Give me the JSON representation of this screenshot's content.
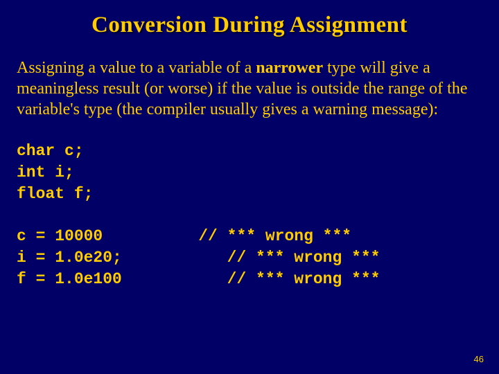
{
  "title": "Conversion During Assignment",
  "paragraph_pre": "Assigning a value to a variable of a ",
  "paragraph_bold": "narrower",
  "paragraph_post": " type will give a meaningless result (or worse) if the value is outside the range of the variable's type (the compiler usually gives a warning message):",
  "code_decls": "char c;\nint i;\nfloat f;",
  "code_assigns": "c = 10000          // *** wrong ***\ni = 1.0e20;           // *** wrong ***\nf = 1.0e100           // *** wrong ***",
  "page_number": "46"
}
